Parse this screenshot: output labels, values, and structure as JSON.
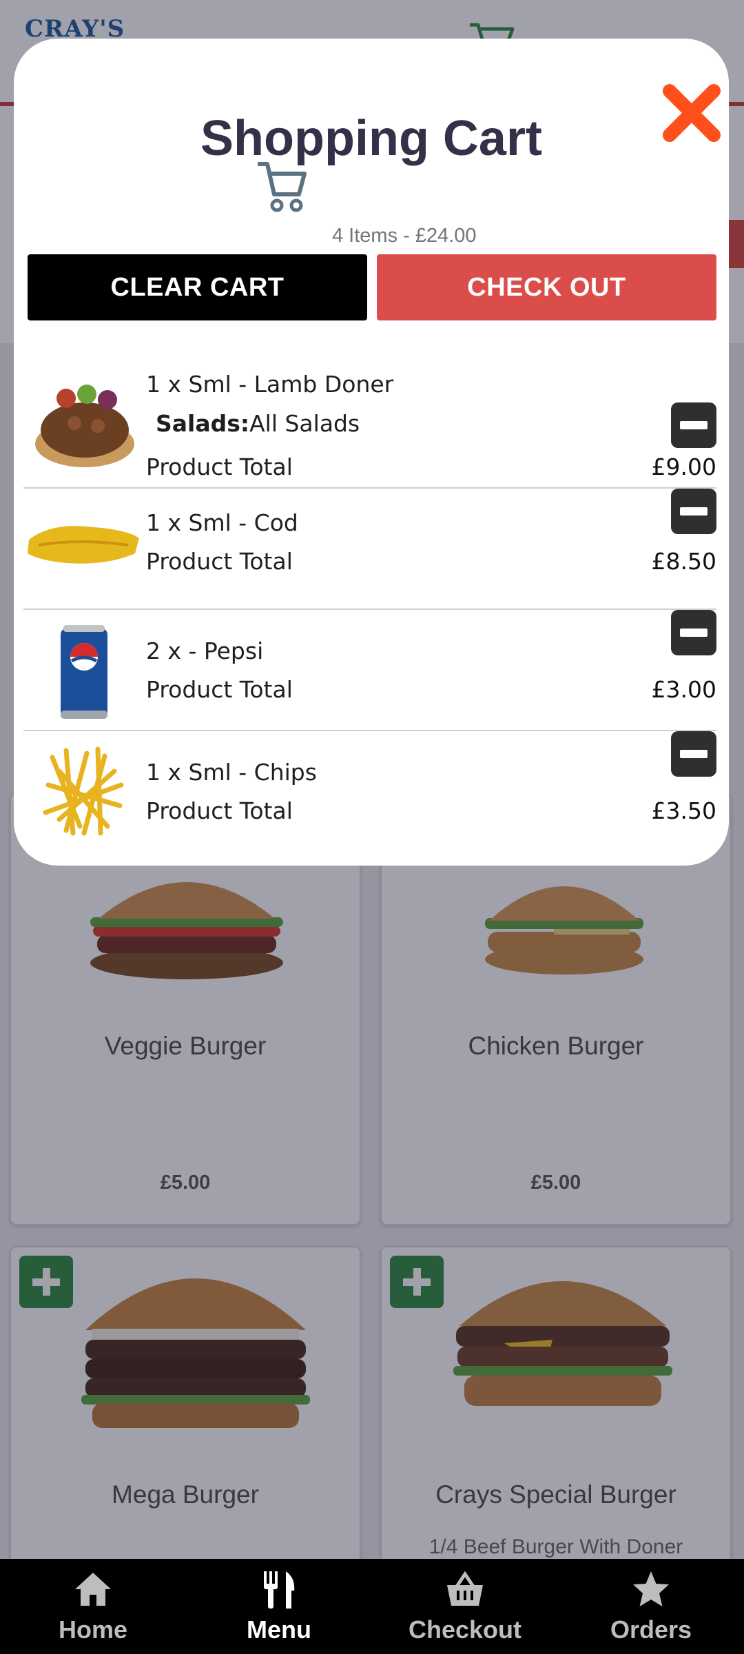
{
  "background": {
    "logo_text": "CRAY'S",
    "products": [
      {
        "name": "Veggie Burger",
        "price": "£5.00"
      },
      {
        "name": "Chicken Burger",
        "price": "£5.00"
      },
      {
        "name": "Mega Burger"
      },
      {
        "name": "Crays Special Burger",
        "description": "1/4 Beef Burger With Doner"
      }
    ]
  },
  "cart_modal": {
    "title": "Shopping Cart",
    "summary": "4 Items - £24.00",
    "clear_label": "CLEAR CART",
    "checkout_label": "CHECK OUT",
    "items": [
      {
        "title": "1 x Sml - Lamb Doner",
        "extra_key": "Salads:",
        "extra_value": "All Salads",
        "total_label": "Product Total",
        "price": "£9.00",
        "image": "lamb-doner"
      },
      {
        "title": "1 x Sml - Cod",
        "total_label": "Product Total",
        "price": "£8.50",
        "image": "cod"
      },
      {
        "title": "2 x - Pepsi",
        "total_label": "Product Total",
        "price": "£3.00",
        "image": "pepsi"
      },
      {
        "title": "1 x Sml - Chips",
        "total_label": "Product Total",
        "price": "£3.50",
        "image": "chips"
      }
    ]
  },
  "bottom_nav": {
    "items": [
      {
        "label": "Home",
        "icon": "home-icon"
      },
      {
        "label": "Menu",
        "icon": "fork-knife-icon",
        "active": true
      },
      {
        "label": "Checkout",
        "icon": "basket-icon"
      },
      {
        "label": "Orders",
        "icon": "star-icon"
      }
    ]
  },
  "colors": {
    "checkout_red": "#db4d4a",
    "close_orange": "#ff4f1a",
    "add_green": "#2e8b3f",
    "title_text": "#343047"
  }
}
